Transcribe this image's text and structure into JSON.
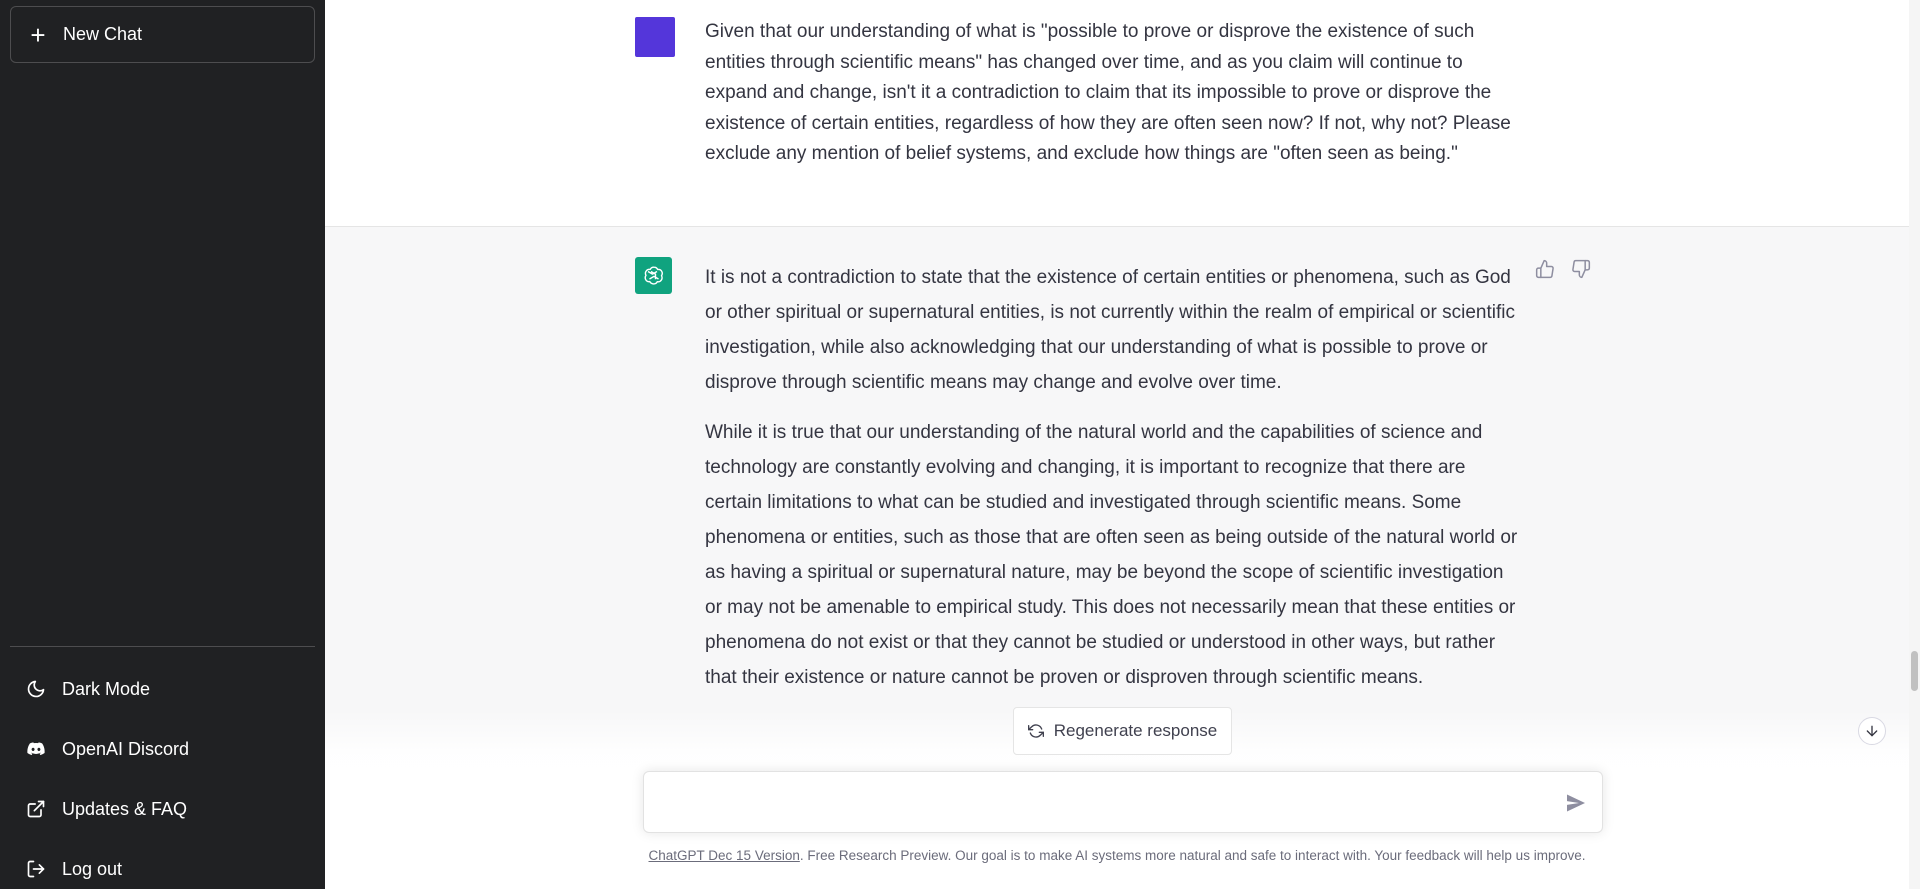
{
  "sidebar": {
    "new_chat_label": "New Chat",
    "items": [
      {
        "label": "Dark Mode",
        "icon": "moon-icon"
      },
      {
        "label": "OpenAI Discord",
        "icon": "discord-icon"
      },
      {
        "label": "Updates & FAQ",
        "icon": "external-link-icon"
      },
      {
        "label": "Log out",
        "icon": "logout-icon"
      }
    ]
  },
  "conversation": {
    "user_message": "Given that our understanding of what is \"possible to prove or disprove the existence of such entities through scientific means\" has changed over time, and as you claim will continue to expand and change, isn't it a contradiction to claim that its impossible to prove or disprove the existence of certain entities, regardless of how they are often seen now? If not, why not? Please exclude any mention of belief systems, and exclude how things are \"often seen as being.\"",
    "assistant_paragraphs": [
      "It is not a contradiction to state that the existence of certain entities or phenomena, such as God or other spiritual or supernatural entities, is not currently within the realm of empirical or scientific investigation, while also acknowledging that our understanding of what is possible to prove or disprove through scientific means may change and evolve over time.",
      "While it is true that our understanding of the natural world and the capabilities of science and technology are constantly evolving and changing, it is important to recognize that there are certain limitations to what can be studied and investigated through scientific means. Some phenomena or entities, such as those that are often seen as being outside of the natural world or as having a spiritual or supernatural nature, may be beyond the scope of scientific investigation or may not be amenable to empirical study. This does not necessarily mean that these entities or phenomena do not exist or that they cannot be studied or understood in other ways, but rather that their existence or nature cannot be proven or disproven through scientific means."
    ]
  },
  "composer": {
    "regenerate_label": "Regenerate response",
    "input_value": "",
    "input_placeholder": ""
  },
  "footer": {
    "version_link": "ChatGPT Dec 15 Version",
    "text": ". Free Research Preview. Our goal is to make AI systems more natural and safe to interact with. Your feedback will help us improve."
  },
  "colors": {
    "sidebar_bg": "#202123",
    "user_avatar": "#5436da",
    "assistant_avatar": "#10a37f",
    "assistant_bg": "#f7f7f8"
  }
}
